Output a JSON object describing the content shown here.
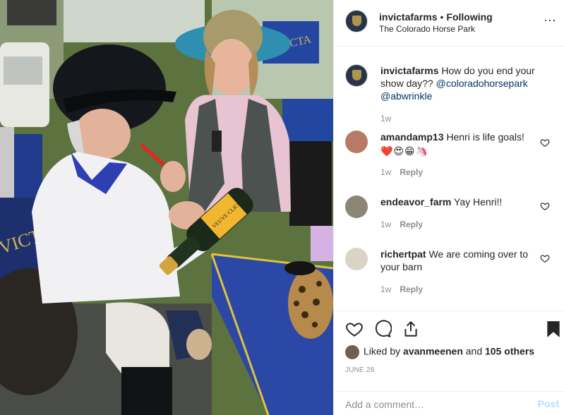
{
  "header": {
    "username": "invictafarms",
    "separator": "•",
    "follow_status": "Following",
    "location": "The Colorado Horse Park",
    "more_glyph": "···"
  },
  "caption": {
    "username": "invictafarms",
    "text": "How do you end your show day??",
    "mentions": [
      "@coloradohorsepark",
      "@abwrinkle"
    ],
    "age": "1w"
  },
  "comments": [
    {
      "username": "amandamp13",
      "text": "Henri is life goals!",
      "emojis": "❤️😍😁🦄",
      "age": "1w",
      "reply_label": "Reply"
    },
    {
      "username": "endeavor_farm",
      "text": "Yay Henri!!",
      "age": "1w",
      "reply_label": "Reply"
    },
    {
      "username": "richertpat",
      "text": "We are coming over to your barn",
      "age": "1w",
      "reply_label": "Reply"
    }
  ],
  "engagement": {
    "liked_prefix": "Liked by",
    "liked_user": "avanmeenen",
    "liked_joiner": "and",
    "liked_others": "105 others",
    "date": "JUNE 28"
  },
  "composer": {
    "placeholder": "Add a comment…",
    "post_label": "Post"
  },
  "photo": {
    "chair_text": "VICT",
    "chair_text_2": "VICTA",
    "bottle_label": "VEUVE CLICQUOT"
  },
  "icons": {
    "more": "more-options-icon",
    "like": "heart-icon",
    "comment": "comment-bubble-icon",
    "share": "share-icon",
    "save": "bookmark-icon",
    "comment_like": "small-heart-icon"
  },
  "colors": {
    "accent_link": "#003569",
    "text": "#262626",
    "secondary": "#8e8e8e",
    "border": "#efefef",
    "post_disabled": "#b2dffc"
  }
}
